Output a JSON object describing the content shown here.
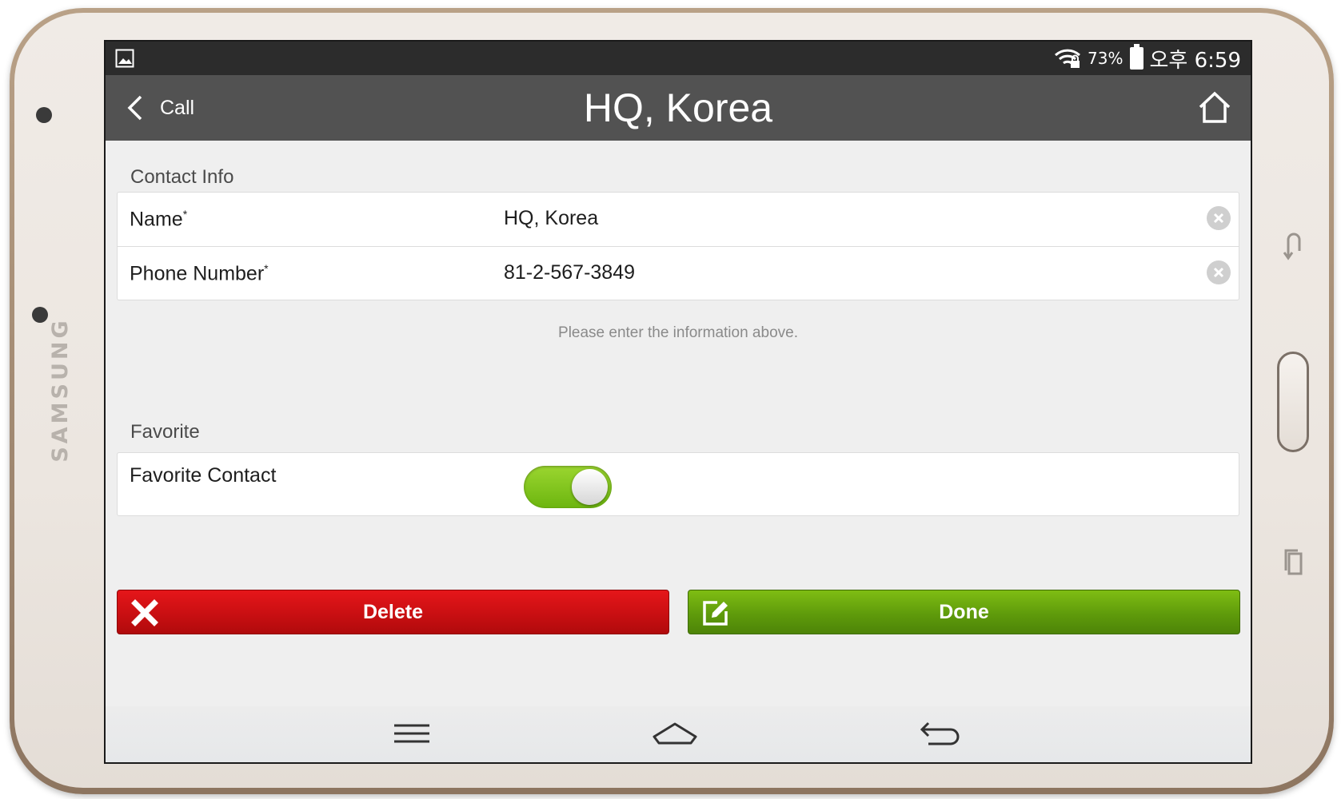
{
  "device": {
    "brand": "SAMSUNG"
  },
  "status_bar": {
    "battery_percent": "73%",
    "time": "오후 6:59"
  },
  "header": {
    "back_label": "Call",
    "title": "HQ, Korea"
  },
  "contact_info": {
    "section_title": "Contact Info",
    "name_label": "Name",
    "name_value": "HQ, Korea",
    "phone_label": "Phone Number",
    "phone_value": "81-2-567-3849",
    "required_marker": "*",
    "hint": "Please enter the information above."
  },
  "favorite": {
    "section_title": "Favorite",
    "label": "Favorite Contact",
    "enabled": true
  },
  "actions": {
    "delete_label": "Delete",
    "done_label": "Done"
  },
  "colors": {
    "header_bg": "#525252",
    "status_bg": "#2c2c2c",
    "delete_red": "#d41115",
    "done_green": "#6aa80e",
    "toggle_green": "#84c61e"
  },
  "icons": {
    "back": "chevron-left-icon",
    "home": "home-icon",
    "clear": "clear-circle-icon",
    "delete": "x-icon",
    "done": "edit-icon",
    "menu": "menu-icon",
    "nav_home": "home-outline-icon",
    "nav_back": "back-arrow-icon"
  }
}
